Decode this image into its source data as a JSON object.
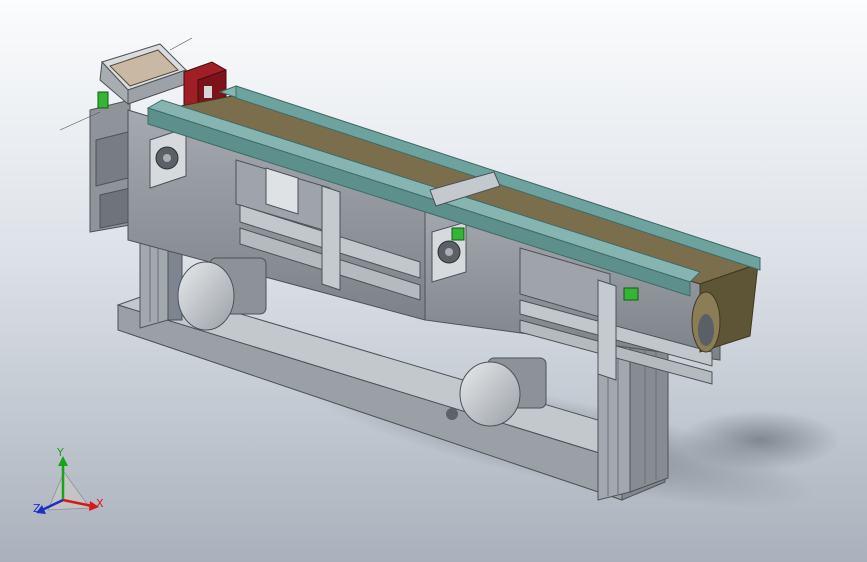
{
  "viewport": {
    "background_top": "#fbfcfd",
    "background_bottom": "#aab1bc"
  },
  "model": {
    "colors": {
      "frame": "#8f969c",
      "frame_dark": "#5f666c",
      "base": "#a7adb3",
      "cover": "#86b5b1",
      "cover_dark": "#5d8f8c",
      "belt": "#7a6e4c",
      "motor": "#c8ccd0",
      "stop_block": "#a01e26",
      "sensor": "#35b535",
      "fixture": "#c9b8a4"
    }
  },
  "triad": {
    "x_label": "X",
    "y_label": "Y",
    "z_label": "Z",
    "x_color": "#d81818",
    "y_color": "#18a318",
    "z_color": "#1e2fc8"
  }
}
